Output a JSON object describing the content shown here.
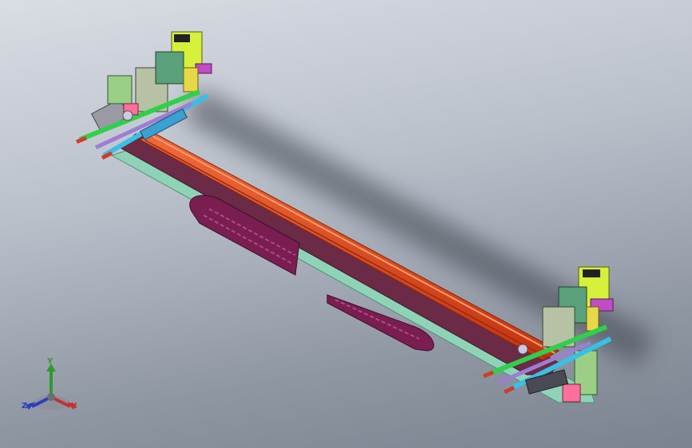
{
  "viewport": {
    "background_colors": [
      "#d9dde4",
      "#8f97a3"
    ]
  },
  "model": {
    "rail_color": "#e0461e",
    "frame_color": "#6b2a45",
    "base_plate_color": "#8fd3b7",
    "energy_chain_color": "#7a1e52",
    "accent_colors": [
      "#d7f03a",
      "#39c0e6",
      "#2fd04a",
      "#c04cc6",
      "#ff6f9b",
      "#d43a2a"
    ]
  },
  "triad": {
    "axes": [
      {
        "id": "x",
        "label": "X",
        "color": "#c23030"
      },
      {
        "id": "y",
        "label": "Y",
        "color": "#2e9a2e"
      },
      {
        "id": "z",
        "label": "Z",
        "color": "#2b3fb5"
      }
    ]
  }
}
